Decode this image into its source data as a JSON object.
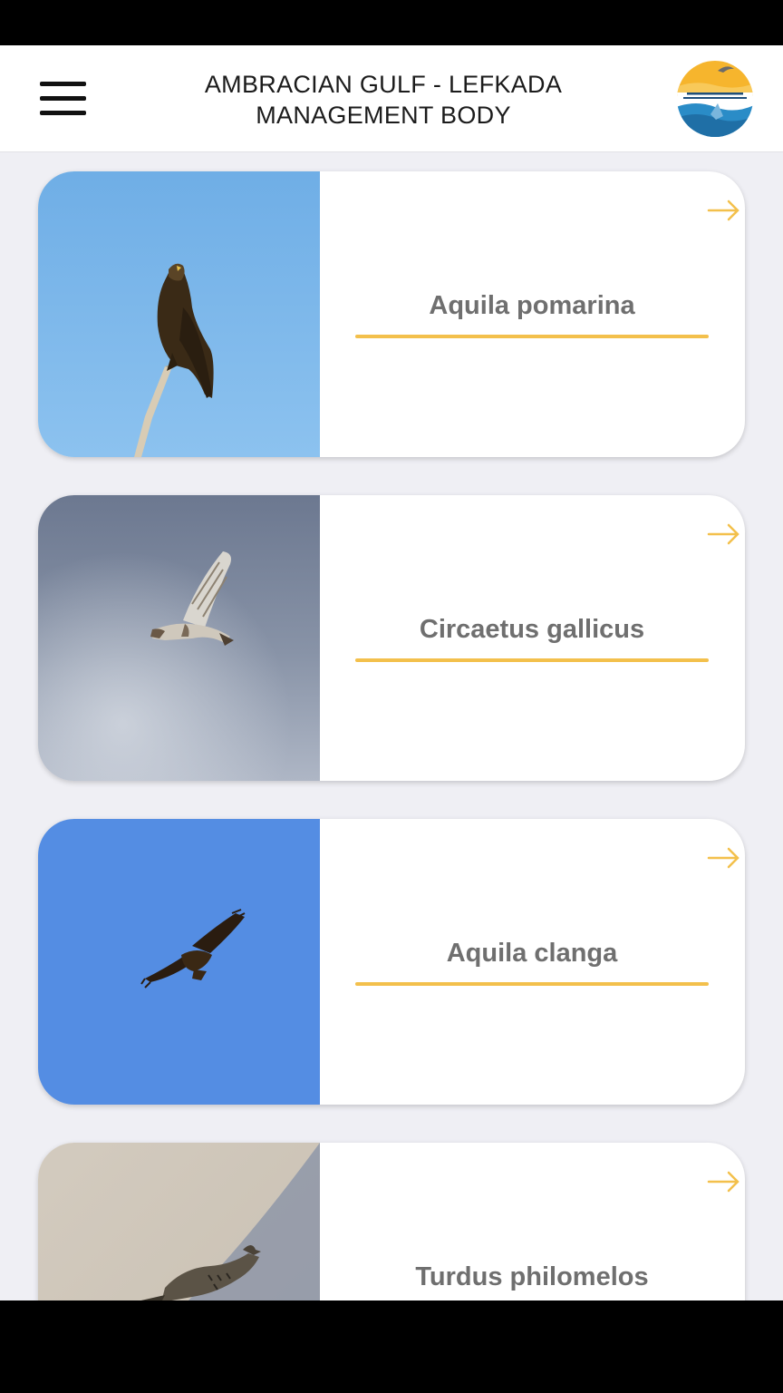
{
  "header": {
    "title_line1": "AMBRACIAN GULF - LEFKADA",
    "title_line2": "MANAGEMENT BODY",
    "menu_icon": "hamburger-menu-icon",
    "logo": "management-body-logo"
  },
  "accent_color": "#f3c04c",
  "species": [
    {
      "name": "Aquila pomarina",
      "photo": "eagle-perched-on-branch"
    },
    {
      "name": "Circaetus gallicus",
      "photo": "raptor-in-flight-grey-sky"
    },
    {
      "name": "Aquila clanga",
      "photo": "eagle-soaring-blue-sky"
    },
    {
      "name": "Turdus philomelos",
      "photo": "thrush-on-ground"
    }
  ]
}
